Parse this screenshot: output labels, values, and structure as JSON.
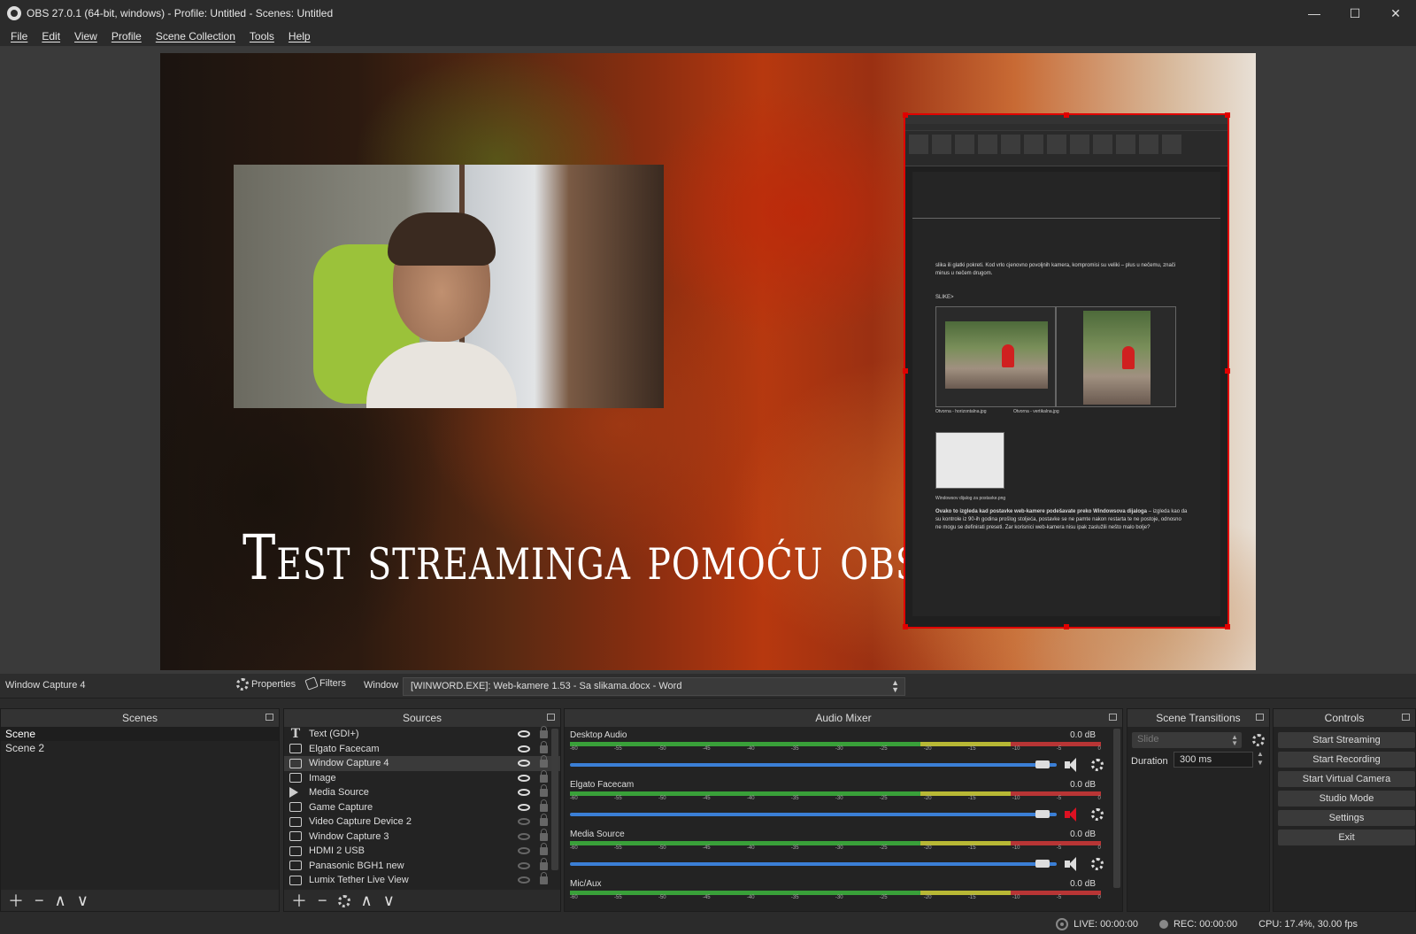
{
  "window": {
    "title": "OBS 27.0.1 (64-bit, windows) - Profile: Untitled - Scenes: Untitled",
    "minimize": "—",
    "maximize": "☐",
    "close": "✕"
  },
  "menu": [
    "File",
    "Edit",
    "View",
    "Profile",
    "Scene Collection",
    "Tools",
    "Help"
  ],
  "preview": {
    "overlay_text": "Test streaminga pomoću obs-a",
    "word": {
      "para1": "slika ili glatki pokreti. Kod vrlo cjenovno povoljnih kamera, kompromisi su veliki – plus u nečemu, znači minus u nečem drugom.",
      "slide": "SLIKE>",
      "cap1": "Otvorna - horizontalna.jpg",
      "cap2": "Otvorna - vertikalna.jpg",
      "cap3": "Windowsov dijalog za postavke.png",
      "para2_bold": "Ovako to izgleda kad postavke web-kamere podešavate preko Windowsova dijaloga",
      "para2": " – izgleda kao da su kontrole iz 90-ih godina prošlog stoljeća, postavke se ne pamte nakon restarta te ne postoje, odnosno ne mogu se definirati preseti. Zar korisnici web-kamera nisu ipak zaslužili nešto malo bolje?"
    }
  },
  "source_bar": {
    "selected": "Window Capture 4",
    "properties": "Properties",
    "filters": "Filters",
    "window_label": "Window",
    "window_value": "[WINWORD.EXE]: Web-kamere 1.53 - Sa slikama.docx - Word"
  },
  "scenes": {
    "title": "Scenes",
    "items": [
      "Scene",
      "Scene 2"
    ]
  },
  "sources": {
    "title": "Sources",
    "items": [
      {
        "name": "Text (GDI+)",
        "icon": "text-icon",
        "visible": true
      },
      {
        "name": "Elgato Facecam",
        "icon": "camera-icon",
        "visible": true
      },
      {
        "name": "Window Capture 4",
        "icon": "window-icon",
        "visible": true
      },
      {
        "name": "Image",
        "icon": "image-icon",
        "visible": true
      },
      {
        "name": "Media Source",
        "icon": "play-icon",
        "visible": true
      },
      {
        "name": "Game Capture",
        "icon": "gamepad-icon",
        "visible": true
      },
      {
        "name": "Video Capture Device 2",
        "icon": "camera-icon",
        "visible": false
      },
      {
        "name": "Window Capture 3",
        "icon": "window-icon",
        "visible": false
      },
      {
        "name": "HDMI 2 USB",
        "icon": "camera-icon",
        "visible": false
      },
      {
        "name": "Panasonic BGH1 new",
        "icon": "camera-icon",
        "visible": false
      },
      {
        "name": "Lumix Tether Live View",
        "icon": "window-icon",
        "visible": false
      }
    ]
  },
  "mixer": {
    "title": "Audio Mixer",
    "ticks": [
      "-60",
      "-55",
      "-50",
      "-45",
      "-40",
      "-35",
      "-30",
      "-25",
      "-20",
      "-15",
      "-10",
      "-5",
      "0"
    ],
    "channels": [
      {
        "name": "Desktop Audio",
        "db": "0.0 dB",
        "muted": false
      },
      {
        "name": "Elgato Facecam",
        "db": "0.0 dB",
        "muted": true
      },
      {
        "name": "Media Source",
        "db": "0.0 dB",
        "muted": false
      },
      {
        "name": "Mic/Aux",
        "db": "0.0 dB",
        "muted": false
      }
    ]
  },
  "transitions": {
    "title": "Scene Transitions",
    "selected": "Slide",
    "duration_label": "Duration",
    "duration_value": "300 ms"
  },
  "controls": {
    "title": "Controls",
    "buttons": [
      "Start Streaming",
      "Start Recording",
      "Start Virtual Camera",
      "Studio Mode",
      "Settings",
      "Exit"
    ]
  },
  "status": {
    "live": "LIVE: 00:00:00",
    "rec": "REC: 00:00:00",
    "cpu": "CPU: 17.4%, 30.00 fps"
  }
}
